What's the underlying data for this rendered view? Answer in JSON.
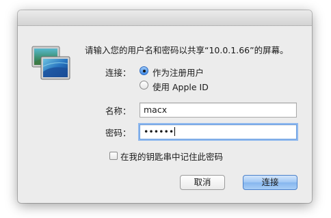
{
  "dialog": {
    "prompt": "请输入您的用户名和密码以共享“10.0.1.66”的屏幕。",
    "connect_label": "连接：",
    "options": [
      "作为注册用户",
      "使用 Apple ID"
    ],
    "selected_option": 0,
    "name_label": "名称：",
    "name_value": "macx",
    "password_label": "密码：",
    "password_mask": "••••••",
    "remember_label": "在我的钥匙串中记住此密码",
    "remember_checked": false,
    "cancel_label": "取消",
    "connect_button": "连接",
    "icon": "screen-sharing-icon"
  }
}
